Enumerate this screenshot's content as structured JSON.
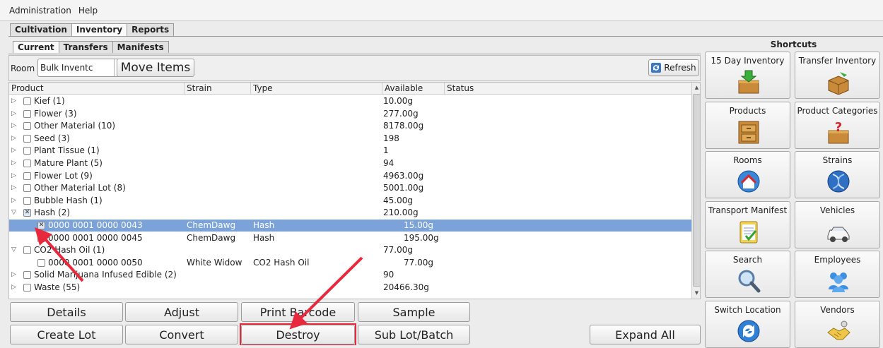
{
  "menu": [
    "Administration",
    "Help"
  ],
  "main_tabs": [
    "Cultivation",
    "Inventory",
    "Reports"
  ],
  "sub_tabs": [
    "Current",
    "Transfers",
    "Manifests"
  ],
  "toolbar": {
    "room_label": "Room",
    "room_value": "Bulk Inventc",
    "move_items": "Move Items",
    "refresh": "Refresh"
  },
  "columns": [
    "Product",
    "Strain",
    "Type",
    "Available",
    "Status"
  ],
  "rows": [
    {
      "name": "Kief (1)",
      "strain": "",
      "type": "",
      "available": "10.00g"
    },
    {
      "name": "Flower (3)",
      "strain": "",
      "type": "",
      "available": "277.00g"
    },
    {
      "name": "Other Material (10)",
      "strain": "",
      "type": "",
      "available": "8178.00g"
    },
    {
      "name": "Seed (3)",
      "strain": "",
      "type": "",
      "available": "198"
    },
    {
      "name": "Plant Tissue (1)",
      "strain": "",
      "type": "",
      "available": "1"
    },
    {
      "name": "Mature Plant (5)",
      "strain": "",
      "type": "",
      "available": "94"
    },
    {
      "name": "Flower Lot (9)",
      "strain": "",
      "type": "",
      "available": "4963.00g"
    },
    {
      "name": "Other Material Lot (8)",
      "strain": "",
      "type": "",
      "available": "5001.00g"
    },
    {
      "name": "Bubble Hash (1)",
      "strain": "",
      "type": "",
      "available": "45.00g"
    },
    {
      "name": "Hash (2)",
      "strain": "",
      "type": "",
      "available": "210.00g"
    },
    {
      "name": "0000 0001 0000 0043",
      "strain": "ChemDawg",
      "type": "Hash",
      "available": "15.00g"
    },
    {
      "name": "0000 0001 0000 0045",
      "strain": "ChemDawg",
      "type": "Hash",
      "available": "195.00g"
    },
    {
      "name": "CO2 Hash Oil (1)",
      "strain": "",
      "type": "",
      "available": "77.00g"
    },
    {
      "name": "0000 0001 0000 0050",
      "strain": "White Widow",
      "type": "CO2 Hash Oil",
      "available": "77.00g"
    },
    {
      "name": "Solid Marijuana Infused Edible (2)",
      "strain": "",
      "type": "",
      "available": "90"
    },
    {
      "name": "Waste (55)",
      "strain": "",
      "type": "",
      "available": "20466.30g"
    }
  ],
  "buttons_row1": [
    "Details",
    "Adjust",
    "Print Barcode",
    "Sample"
  ],
  "buttons_row2": [
    "Create Lot",
    "Convert",
    "Destroy",
    "Sub Lot/Batch"
  ],
  "expand_all": "Expand All",
  "shortcuts": {
    "title": "Shortcuts",
    "items": [
      {
        "label": "15 Day Inventory",
        "icon": "box-down-icon"
      },
      {
        "label": "Transfer Inventory",
        "icon": "box-transfer-icon"
      },
      {
        "label": "Products",
        "icon": "cabinet-icon"
      },
      {
        "label": "Product Categories",
        "icon": "box-question-icon"
      },
      {
        "label": "Rooms",
        "icon": "room-icon"
      },
      {
        "label": "Strains",
        "icon": "dna-icon"
      },
      {
        "label": "Transport Manifest",
        "icon": "clipboard-check-icon"
      },
      {
        "label": "Vehicles",
        "icon": "car-icon"
      },
      {
        "label": "Search",
        "icon": "magnifier-icon"
      },
      {
        "label": "Employees",
        "icon": "people-icon"
      },
      {
        "label": "Switch Location",
        "icon": "refresh-icon"
      },
      {
        "label": "Vendors",
        "icon": "handshake-icon"
      }
    ]
  },
  "colors": {
    "selection": "#7ba3d9",
    "annotation": "#e8283c"
  }
}
